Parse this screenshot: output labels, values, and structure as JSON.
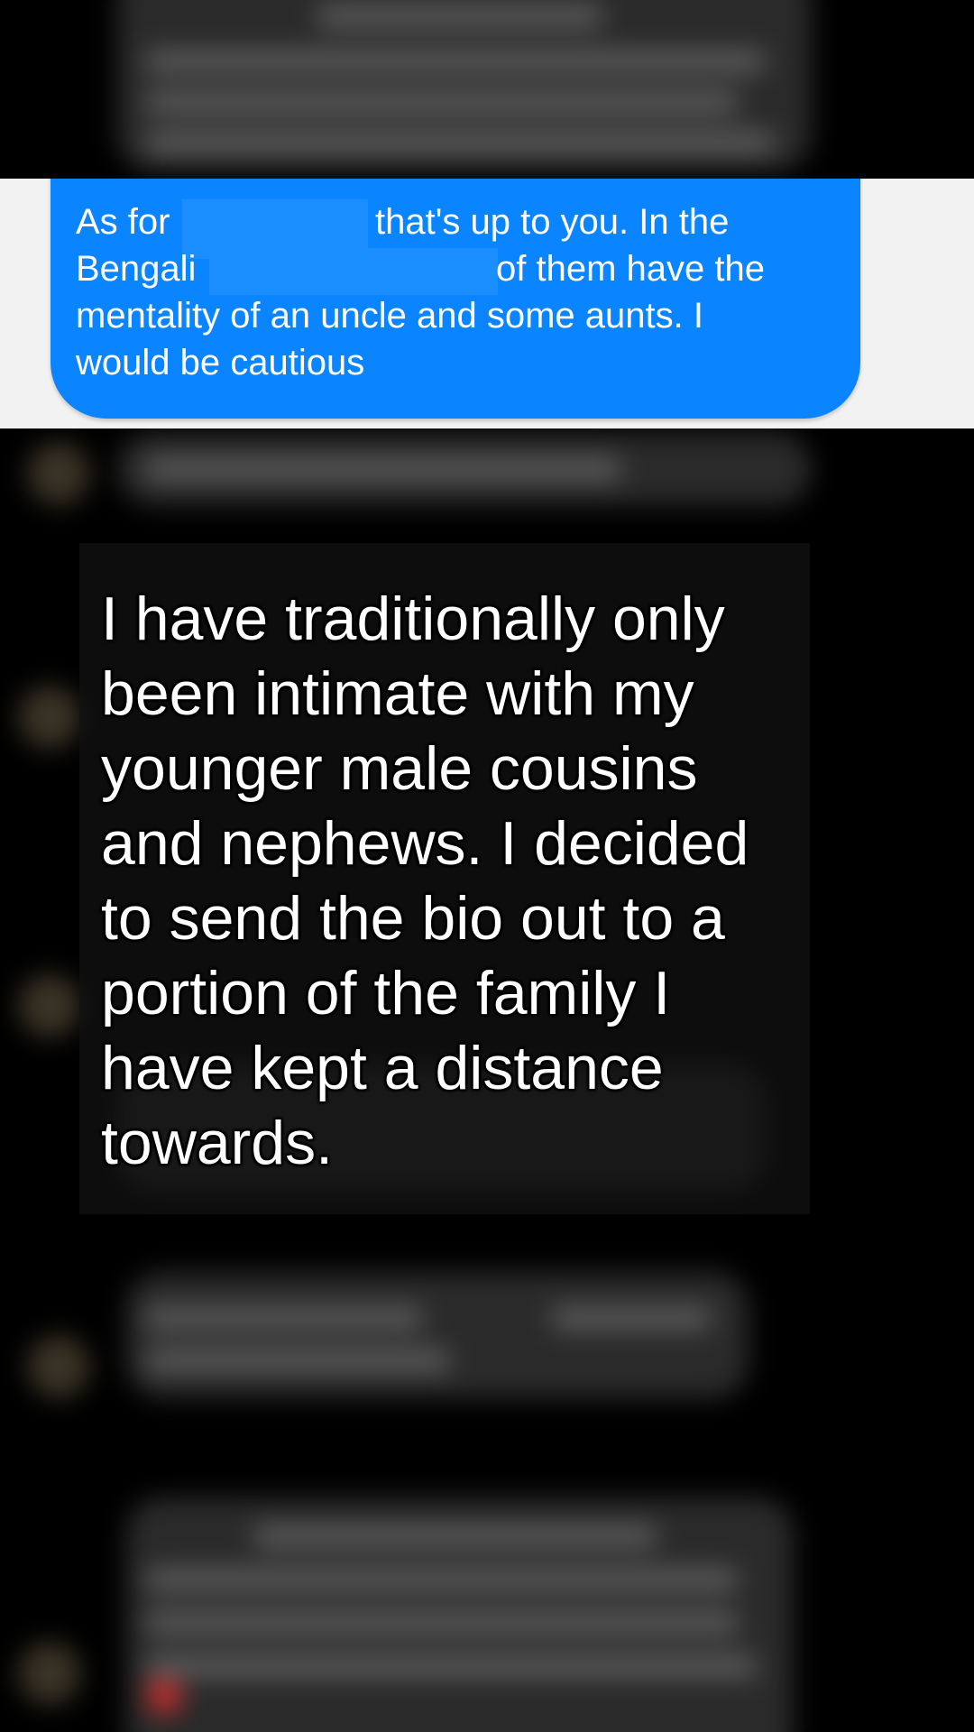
{
  "highlighted_message": {
    "lines": [
      {
        "before": "As for",
        "after": "that's up to you. In the"
      },
      {
        "before": "Bengali",
        "after": "of them have the"
      },
      {
        "text": "mentality of an uncle and some aunts. I"
      },
      {
        "text": "would be cautious"
      }
    ],
    "bubble_color": "#0a84ff"
  },
  "caption": {
    "text": "I have traditionally only been intimate with my younger male cousins and nephews. I decided to send the bio out to a portion of the family I have kept a distance towards."
  },
  "colors": {
    "background": "#000000",
    "strip_background": "#f2f2f2",
    "text_on_bubble": "#ffffff"
  }
}
